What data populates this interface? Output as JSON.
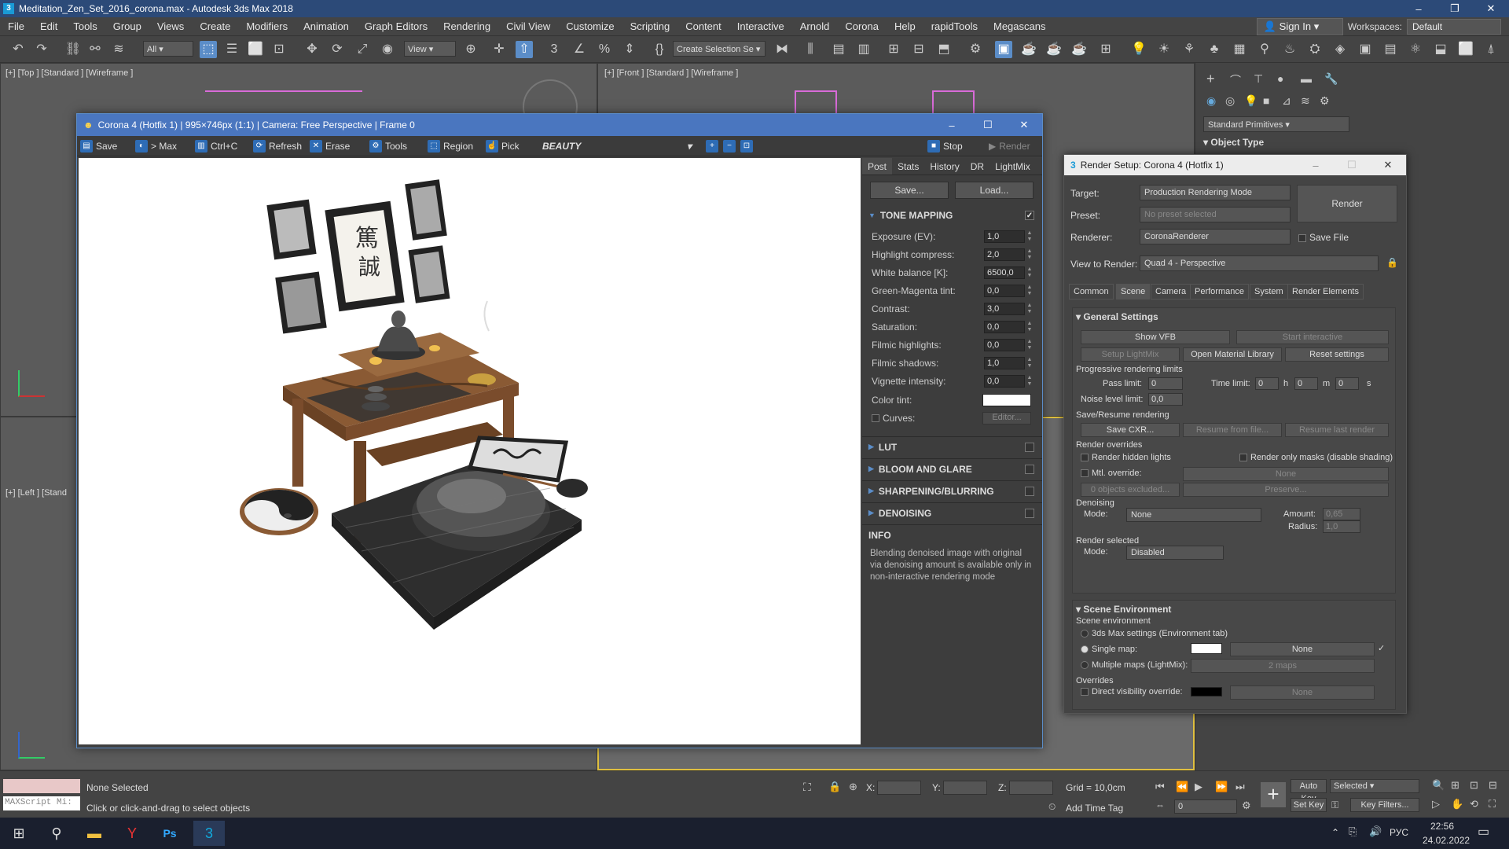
{
  "title": "Meditation_Zen_Set_2016_corona.max - Autodesk 3ds Max 2018",
  "menu": [
    "File",
    "Edit",
    "Tools",
    "Group",
    "Views",
    "Create",
    "Modifiers",
    "Animation",
    "Graph Editors",
    "Rendering",
    "Civil View",
    "Customize",
    "Scripting",
    "Content",
    "Interactive",
    "Arnold",
    "Corona",
    "Help",
    "rapidTools",
    "Megascans"
  ],
  "signin": "Sign In",
  "workspaces_label": "Workspaces:",
  "workspace": "Default",
  "toolbar": {
    "filter": "All",
    "view": "View",
    "selset": "Create Selection Se"
  },
  "viewports": {
    "top": "[+] [Top ] [Standard ] [Wireframe ]",
    "front": "[+] [Front ] [Standard ] [Wireframe ]",
    "left": "[+] [Left ] [Stand"
  },
  "cmd": {
    "dropdown": "Standard Primitives",
    "section": "Object Type"
  },
  "vfb": {
    "title": "Corona 4 (Hotfix 1) | 995×746px (1:1) | Camera: Free Perspective | Frame 0",
    "tools": [
      "Save",
      "> Max",
      "Ctrl+C",
      "Refresh",
      "Erase",
      "Tools",
      "Region",
      "Pick"
    ],
    "pass": "BEAUTY",
    "stop": "Stop",
    "render": "Render",
    "tabs": [
      "Post",
      "Stats",
      "History",
      "DR",
      "LightMix"
    ],
    "save_btn": "Save...",
    "load_btn": "Load...",
    "tone_mapping": "TONE MAPPING",
    "params": [
      {
        "label": "Exposure (EV):",
        "value": "1,0"
      },
      {
        "label": "Highlight compress:",
        "value": "2,0"
      },
      {
        "label": "White balance [K]:",
        "value": "6500,0"
      },
      {
        "label": "Green-Magenta tint:",
        "value": "0,0"
      },
      {
        "label": "Contrast:",
        "value": "3,0"
      },
      {
        "label": "Saturation:",
        "value": "0,0"
      },
      {
        "label": "Filmic highlights:",
        "value": "0,0"
      },
      {
        "label": "Filmic shadows:",
        "value": "1,0"
      },
      {
        "label": "Vignette intensity:",
        "value": "0,0"
      }
    ],
    "color_tint": "Color tint:",
    "curves": "Curves:",
    "editor": "Editor...",
    "sections": [
      "LUT",
      "BLOOM AND GLARE",
      "SHARPENING/BLURRING",
      "DENOISING"
    ],
    "info_title": "INFO",
    "info_text": "Blending denoised image with original via denoising amount is available only in non-interactive rendering mode"
  },
  "rs": {
    "title": "Render Setup: Corona 4 (Hotfix 1)",
    "target_label": "Target:",
    "target": "Production Rendering Mode",
    "preset_label": "Preset:",
    "preset": "No preset selected",
    "renderer_label": "Renderer:",
    "renderer": "CoronaRenderer",
    "savefile": "Save File",
    "view_label": "View to Render:",
    "view": "Quad 4 - Perspective",
    "render_btn": "Render",
    "tabs": [
      "Common",
      "Scene",
      "Camera",
      "Performance",
      "System",
      "Render Elements"
    ],
    "general": "General Settings",
    "show_vfb": "Show VFB",
    "start_interactive": "Start interactive",
    "setup_lightmix": "Setup LightMix",
    "open_mat": "Open Material Library",
    "reset": "Reset settings",
    "prog_limits": "Progressive rendering limits",
    "pass_limit": "Pass limit:",
    "pass_val": "0",
    "time_limit": "Time limit:",
    "h": "h",
    "m": "m",
    "s": "s",
    "t0": "0",
    "t1": "0",
    "t2": "0",
    "noise_limit": "Noise level limit:",
    "noise_val": "0,0",
    "save_resume": "Save/Resume rendering",
    "save_cxr": "Save CXR...",
    "resume_file": "Resume from file...",
    "resume_last": "Resume last render",
    "overrides": "Render overrides",
    "hidden_lights": "Render hidden lights",
    "only_masks": "Render only masks (disable shading)",
    "mtl_override": "Mtl. override:",
    "none": "None",
    "objects_excluded": "0 objects excluded...",
    "preserve": "Preserve...",
    "denoising": "Denoising",
    "mode_label": "Mode:",
    "den_mode": "None",
    "amount_label": "Amount:",
    "amount": "0,65",
    "radius_label": "Radius:",
    "radius": "1,0",
    "render_selected": "Render selected",
    "sel_mode": "Disabled",
    "scene_env": "Scene Environment",
    "scene_env_sub": "Scene environment",
    "env_3ds": "3ds Max settings (Environment tab)",
    "single_map": "Single map:",
    "multi_maps": "Multiple maps (LightMix):",
    "maps2": "2 maps",
    "overrides2": "Overrides",
    "direct_vis": "Direct visibility override:"
  },
  "status": {
    "maxscript": "MAXScript Mi:",
    "none_selected": "None Selected",
    "hint": "Click or click-and-drag to select objects",
    "x": "X:",
    "y": "Y:",
    "z": "Z:",
    "grid": "Grid = 10,0cm",
    "add_time_tag": "Add Time Tag",
    "auto_key": "Auto Key",
    "selected": "Selected",
    "set_key": "Set Key",
    "key_filters": "Key Filters...",
    "frame": "0"
  },
  "taskbar": {
    "lang": "РУС",
    "time": "22:56",
    "date": "24.02.2022"
  }
}
